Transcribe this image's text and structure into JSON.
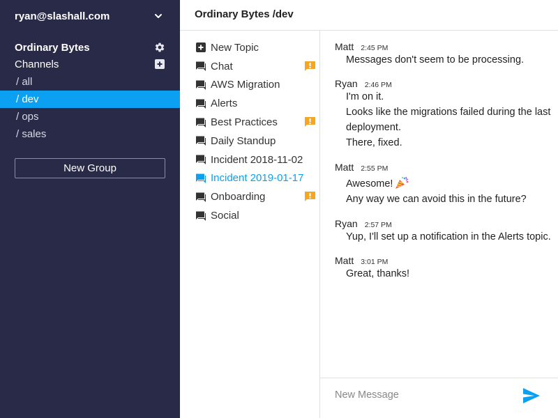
{
  "account": {
    "name": "ryan@slashall.com"
  },
  "group": {
    "name": "Ordinary Bytes"
  },
  "channels_label": "Channels",
  "channels": [
    {
      "label": "/ all",
      "active": false
    },
    {
      "label": "/ dev",
      "active": true
    },
    {
      "label": "/ ops",
      "active": false
    },
    {
      "label": "/ sales",
      "active": false
    }
  ],
  "new_group_label": "New Group",
  "header": {
    "title": "Ordinary Bytes /dev"
  },
  "topics": [
    {
      "label": "New Topic",
      "icon": "plus-square-icon",
      "alert": false,
      "active": false
    },
    {
      "label": "Chat",
      "icon": "chat-icon",
      "alert": true,
      "active": false
    },
    {
      "label": "AWS Migration",
      "icon": "chat-icon",
      "alert": false,
      "active": false
    },
    {
      "label": "Alerts",
      "icon": "chat-icon",
      "alert": false,
      "active": false
    },
    {
      "label": "Best Practices",
      "icon": "chat-icon",
      "alert": true,
      "active": false
    },
    {
      "label": "Daily Standup",
      "icon": "chat-icon",
      "alert": false,
      "active": false
    },
    {
      "label": "Incident 2018-11-02",
      "icon": "chat-icon",
      "alert": false,
      "active": false
    },
    {
      "label": "Incident 2019-01-17",
      "icon": "chat-icon",
      "alert": false,
      "active": true
    },
    {
      "label": "Onboarding",
      "icon": "chat-icon",
      "alert": true,
      "active": false
    },
    {
      "label": "Social",
      "icon": "chat-icon",
      "alert": false,
      "active": false
    }
  ],
  "messages": [
    {
      "author": "Matt",
      "time": "2:45 PM",
      "lines": [
        "Messages don't seem to be processing."
      ]
    },
    {
      "author": "Ryan",
      "time": "2:46 PM",
      "lines": [
        "I'm on it.",
        "Looks like the migrations failed during the last",
        "deployment.",
        "There, fixed."
      ]
    },
    {
      "author": "Matt",
      "time": "2:55 PM",
      "lines": [
        "Awesome!",
        "Any way we can avoid this in the future?"
      ]
    },
    {
      "author": "Ryan",
      "time": "2:57 PM",
      "lines": [
        "Yup, I'll set up a notification in the Alerts topic."
      ]
    },
    {
      "author": "Matt",
      "time": "3:01 PM",
      "lines": [
        "Great, thanks!"
      ]
    }
  ],
  "composer": {
    "placeholder": "New Message"
  },
  "colors": {
    "sidebar_bg": "#282a47",
    "accent": "#0ba0f2",
    "alert": "#f5a623"
  }
}
